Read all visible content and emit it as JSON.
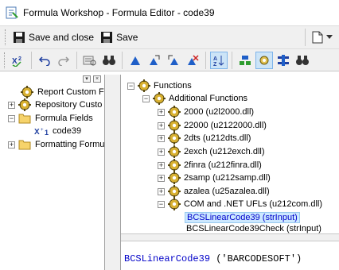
{
  "window": {
    "title": "Formula Workshop - Formula Editor - code39"
  },
  "toolbar": {
    "save_and_close_label": "Save and close",
    "save_label": "Save"
  },
  "left_tree": {
    "items": [
      {
        "label": "Report Custom F"
      },
      {
        "label": "Repository Custo"
      },
      {
        "label": "Formula Fields"
      },
      {
        "label": "code39"
      },
      {
        "label": "Formatting Formu"
      }
    ]
  },
  "function_tree": {
    "root": "Functions",
    "additional": "Additional Functions",
    "items": [
      "2000 (u2l2000.dll)",
      "22000 (u2122000.dll)",
      "2dts (u212dts.dll)",
      "2exch (u212exch.dll)",
      "2finra (u212finra.dll)",
      "2samp (u212samp.dll)",
      "azalea (u25azalea.dll)",
      "COM and .NET UFLs (u212com.dll)"
    ],
    "children": [
      "BCSLinearCode39 (strInput)",
      "BCSLinearCode39Check (strInput)"
    ]
  },
  "editor": {
    "function_name": "BCSLinearCode39",
    "arguments": " ('BARCODESOFT')"
  },
  "colors": {
    "selection": "#cce8ff",
    "code_blue": "#0000c8",
    "folder": "#f6d36b"
  }
}
